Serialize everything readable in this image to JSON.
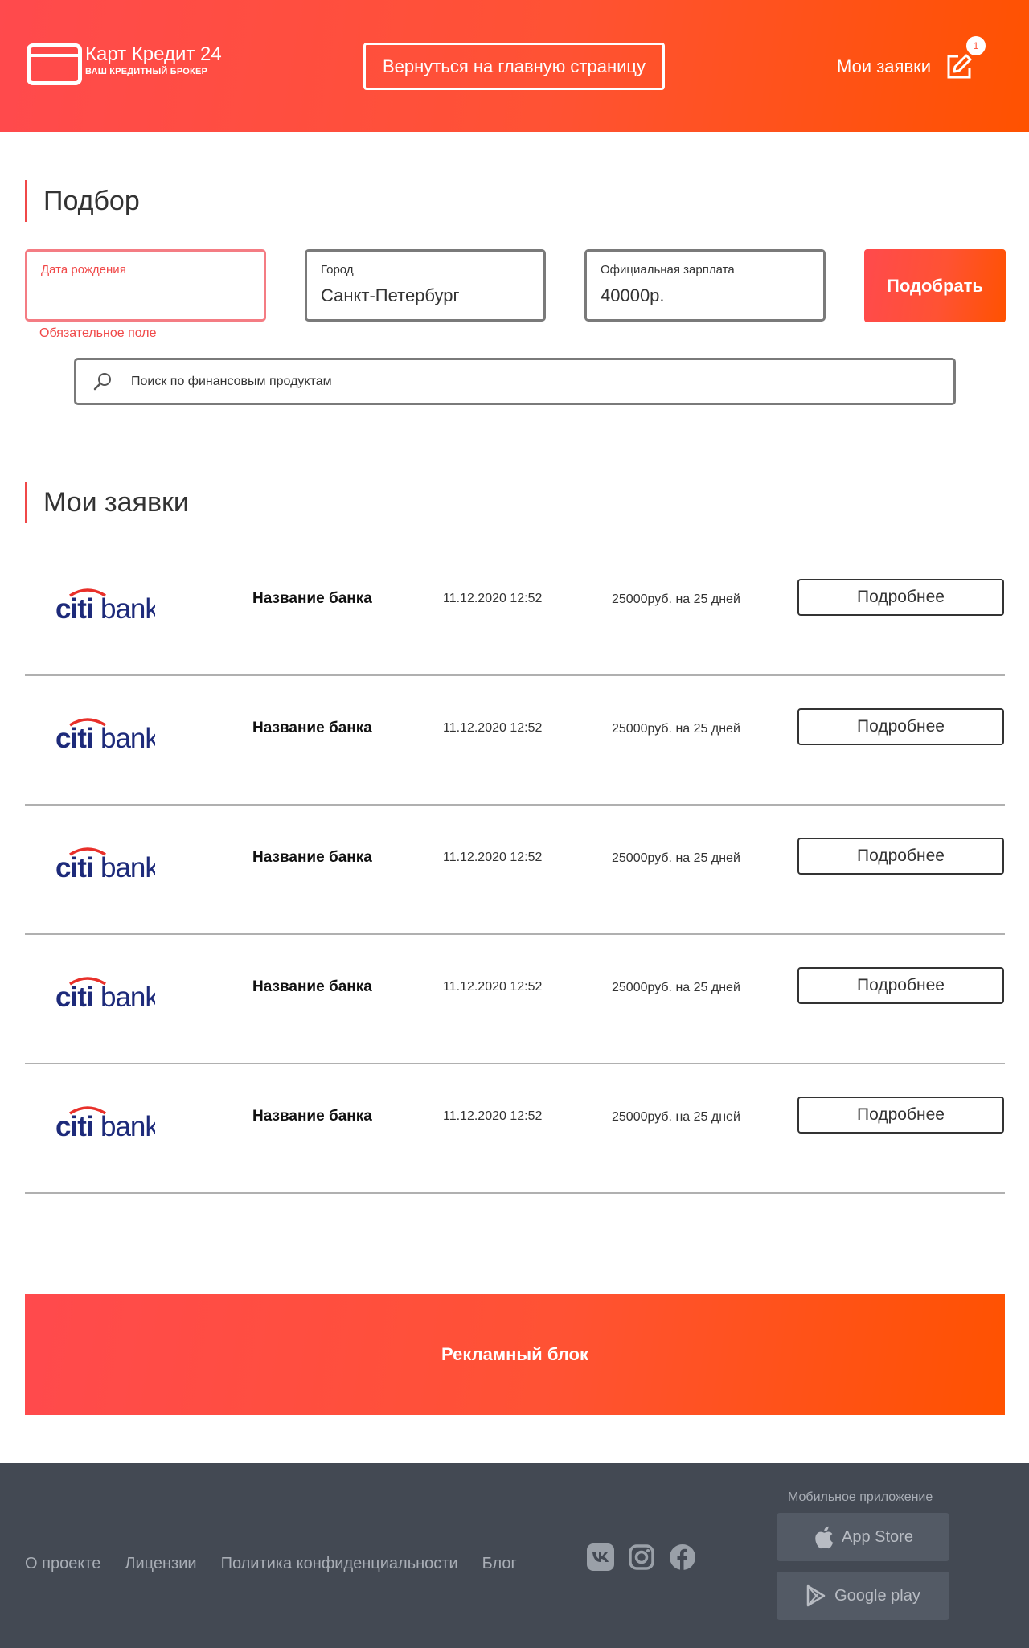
{
  "header": {
    "logo_title": "Карт Кредит 24",
    "logo_subtitle": "ВАШ КРЕДИТНЫЙ БРОКЕР",
    "home_button": "Вернуться на главную страницу",
    "my_applications": "Мои заявки",
    "badge_count": "1"
  },
  "selection": {
    "title": "Подбор",
    "birth_date": {
      "label": "Дата рождения",
      "value": "",
      "error": "Обязательное поле"
    },
    "city": {
      "label": "Город",
      "value": "Санкт-Петербург"
    },
    "salary": {
      "label": "Официальная зарплата",
      "value": "40000р."
    },
    "submit": "Подобрать",
    "search_placeholder": "Поиск по финансовым продуктам"
  },
  "applications": {
    "title": "Мои заявки",
    "items": [
      {
        "logo": "citibank",
        "bank": "Название банка",
        "date": "11.12.2020 12:52",
        "amount": "25000руб. на 25 дней",
        "button": "Подробнее"
      },
      {
        "logo": "citibank",
        "bank": "Название банка",
        "date": "11.12.2020 12:52",
        "amount": "25000руб. на 25 дней",
        "button": "Подробнее"
      },
      {
        "logo": "citibank",
        "bank": "Название банка",
        "date": "11.12.2020 12:52",
        "amount": "25000руб. на 25 дней",
        "button": "Подробнее"
      },
      {
        "logo": "citibank",
        "bank": "Название банка",
        "date": "11.12.2020 12:52",
        "amount": "25000руб. на 25 дней",
        "button": "Подробнее"
      },
      {
        "logo": "citibank",
        "bank": "Название банка",
        "date": "11.12.2020 12:52",
        "amount": "25000руб. на 25 дней",
        "button": "Подробнее"
      }
    ]
  },
  "ad": {
    "label": "Рекламный блок"
  },
  "footer": {
    "links": [
      "О проекте",
      "Лицензии",
      "Политика конфиденциальности",
      "Блог"
    ],
    "social": [
      "vk-icon",
      "instagram-icon",
      "facebook-icon"
    ],
    "mobile_label": "Мобильное приложение",
    "app_store": "App Store",
    "google_play": "Google play"
  },
  "colors": {
    "accent_start": "#ff4a4d",
    "accent_end": "#ff5200",
    "error": "#f04848",
    "footer_bg": "#434953"
  }
}
